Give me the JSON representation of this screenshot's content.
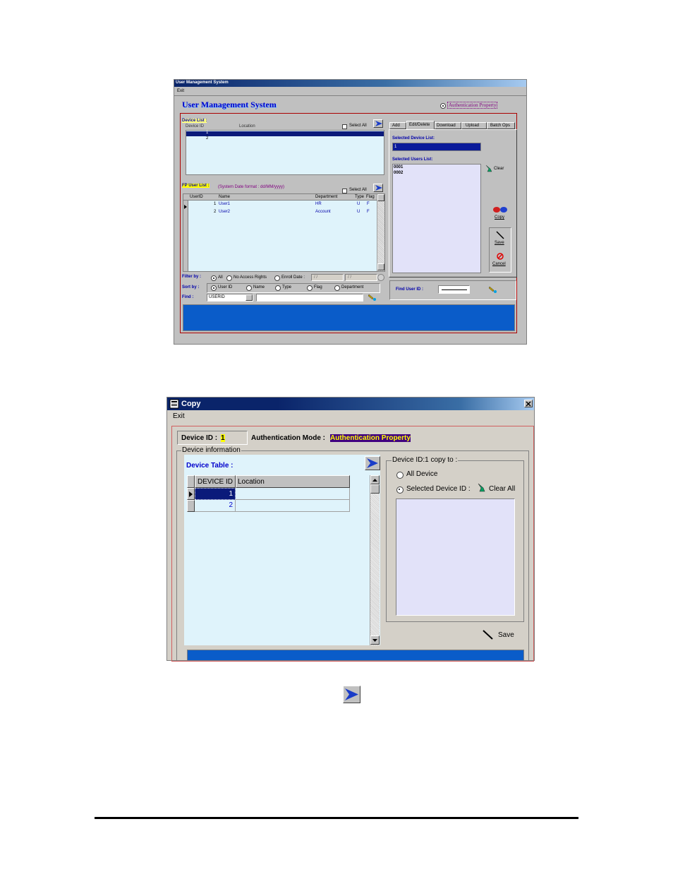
{
  "ums": {
    "window_title": "User Management System",
    "menu_exit": "Exit",
    "heading": "User Management System",
    "auth_option": "Authentication Property",
    "device_list": {
      "label": "Device List :",
      "col_device_id": "Device ID",
      "col_location": "Location",
      "select_all": "Select All",
      "rows": [
        {
          "id": "1"
        },
        {
          "id": "2"
        }
      ]
    },
    "fp_user_list": {
      "label": "FP User List :",
      "date_hint": "(System Date format : dd/MM/yyyy)",
      "select_all": "Select All",
      "columns": [
        "UserID",
        "Name",
        "Department",
        "Type",
        "Flag"
      ],
      "rows": [
        {
          "id": "1",
          "name": "User1",
          "dept": "HR",
          "type": "U",
          "flag": "F"
        },
        {
          "id": "2",
          "name": "User2",
          "dept": "Account",
          "type": "U",
          "flag": "F"
        }
      ]
    },
    "filter": {
      "label": "Filter by :",
      "options": [
        "All",
        "No Access Rights",
        "Enroll Date :"
      ],
      "date_from": "/ /",
      "date_to": "/ /"
    },
    "sort": {
      "label": "Sort by :",
      "options": [
        "User ID",
        "Name",
        "Type",
        "Flag",
        "Department"
      ]
    },
    "find": {
      "label": "Find :",
      "field_value": "USERID",
      "text_value": ""
    },
    "tabs": [
      "Add",
      "Edit/Delete",
      "Download",
      "Upload",
      "Batch Ops"
    ],
    "selected_device_label": "Selected Device List:",
    "selected_device_value": "1",
    "selected_users_label": "Selected Users List:",
    "selected_users": [
      "0001",
      "0002"
    ],
    "clear": "Clear",
    "copy": "Copy",
    "save": "Save",
    "cancel": "Cancel",
    "find_user_label": "Find User ID :"
  },
  "copy": {
    "window_title": "Copy",
    "menu_exit": "Exit",
    "device_id_label": "Device ID :",
    "device_id_value": "1",
    "auth_mode_label": "Authentication Mode :",
    "auth_mode_value": "Authentication Property",
    "device_info_label": "Device information",
    "device_table_label": "Device Table :",
    "columns": [
      "DEVICE ID",
      "Location"
    ],
    "rows": [
      {
        "id": "1",
        "location": ""
      },
      {
        "id": "2",
        "location": ""
      }
    ],
    "copy_to_label": "Device ID:1 copy to :",
    "all_device": "All Device",
    "selected_device": "Selected Device ID :",
    "clear_all": "Clear All",
    "save": "Save"
  },
  "colors": {
    "title_bar": "#0a246a",
    "list_bg": "#dff3fb",
    "lavender": "#e2e2f9",
    "status_blue": "#0a5cc9",
    "highlight_yellow": "#ffff00"
  }
}
